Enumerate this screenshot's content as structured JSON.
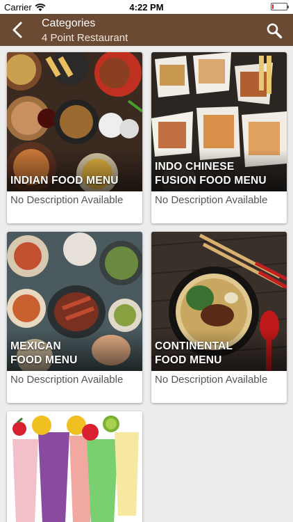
{
  "status": {
    "carrier": "Carrier",
    "time": "4:22 PM",
    "battery_level": 0.1,
    "battery_color": "#e02020"
  },
  "header": {
    "title": "Categories",
    "subtitle": "4 Point Restaurant",
    "background": "#6b4a33",
    "back_icon": "chevron-left-icon",
    "search_icon": "search-icon"
  },
  "categories": [
    {
      "title_line1": "INDIAN FOOD MENU",
      "title_line2": "",
      "description": "No Description Available"
    },
    {
      "title_line1": "INDO CHINESE",
      "title_line2": "FUSION FOOD MENU",
      "description": "No Description Available"
    },
    {
      "title_line1": "MEXICAN",
      "title_line2": "FOOD MENU",
      "description": "No Description Available"
    },
    {
      "title_line1": "CONTINENTAL",
      "title_line2": "FOOD MENU",
      "description": "No Description Available"
    },
    {
      "title_line1": "",
      "title_line2": "",
      "description": ""
    }
  ]
}
